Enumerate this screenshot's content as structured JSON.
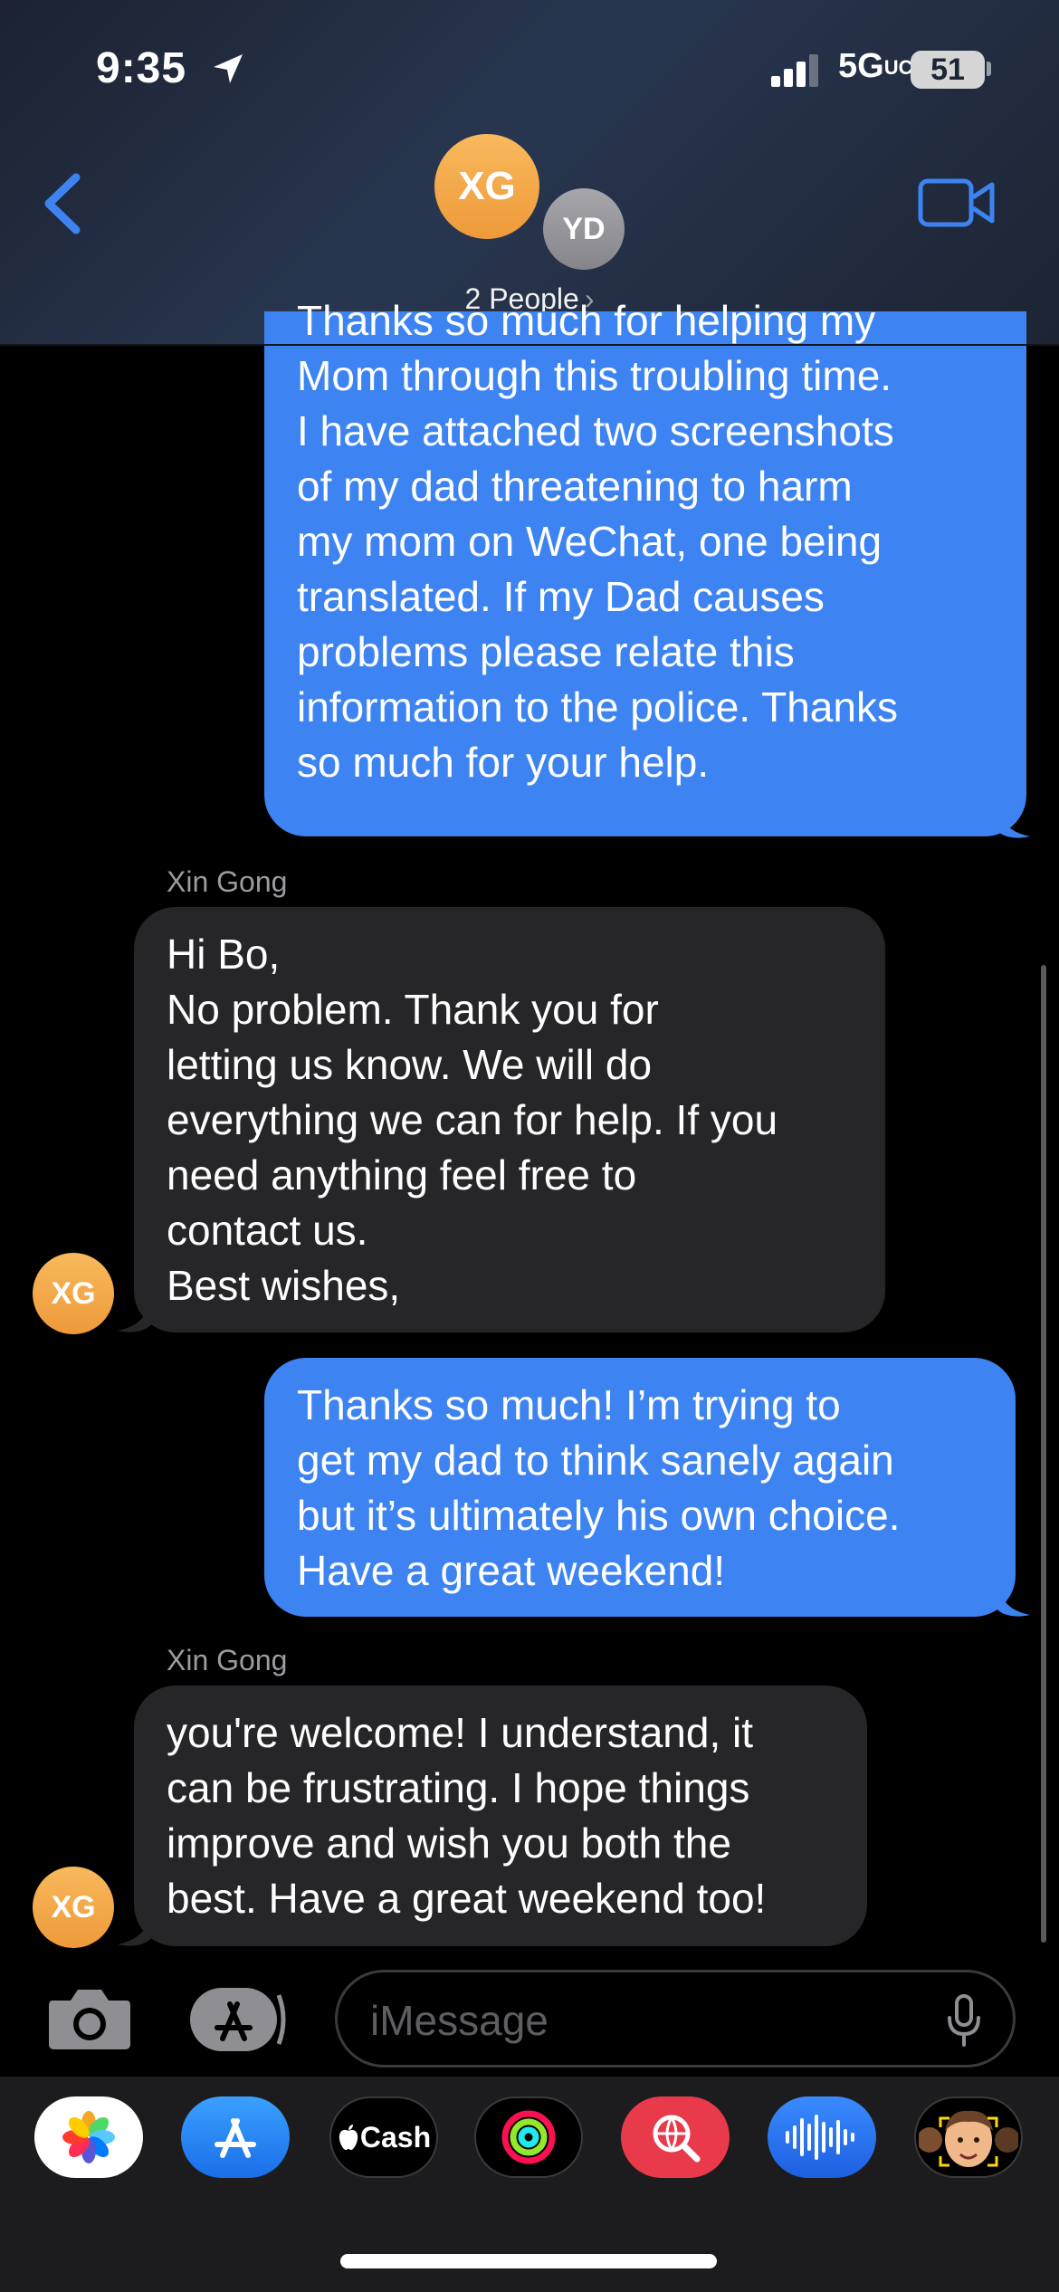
{
  "status": {
    "time": "9:35",
    "network": "5G",
    "network_suffix": "UC",
    "battery": "51"
  },
  "header": {
    "avatars": [
      "XG",
      "YD"
    ],
    "participants_label": "2 People",
    "chevron": "›"
  },
  "messages": [
    {
      "type": "sent",
      "lines": [
        "Thanks so much for helping my",
        "Mom through this troubling time.",
        "I have attached two screenshots",
        "of my dad threatening to harm",
        "my mom on WeChat, one being",
        "translated. If my Dad causes",
        "problems please relate this",
        "information to the police. Thanks",
        "so much for your help."
      ]
    },
    {
      "type": "received",
      "sender": "Xin Gong",
      "avatar": "XG",
      "lines": [
        "Hi Bo,",
        "No problem. Thank you for",
        "letting us know. We will do",
        "everything we can for help. If you",
        "need anything feel free to",
        "contact us.",
        "Best wishes,"
      ]
    },
    {
      "type": "sent",
      "lines": [
        "Thanks so much! I’m trying to",
        "get my dad to think sanely again",
        "but it’s ultimately his own choice.",
        "Have a great weekend!"
      ]
    },
    {
      "type": "received",
      "sender": "Xin Gong",
      "avatar": "XG",
      "lines": [
        "you're welcome! I understand, it",
        "can be frustrating. I hope things",
        "improve and wish you both the",
        "best. Have a great weekend too!"
      ]
    }
  ],
  "input": {
    "placeholder": "iMessage"
  },
  "app_drawer": {
    "apps": [
      "photos-icon",
      "app-store-icon",
      "apple-cash-icon",
      "fitness-icon",
      "image-search-icon",
      "audio-message-icon",
      "memoji-icon"
    ],
    "cash_label": "Cash"
  },
  "colors": {
    "sent_bubble": "#3d84f2",
    "received_bubble": "#262628",
    "avatar_orange": "#f2a444",
    "header_bg": "#283650"
  }
}
